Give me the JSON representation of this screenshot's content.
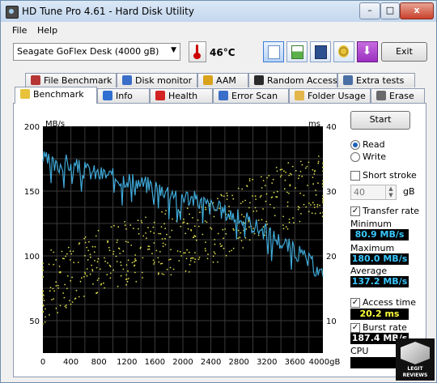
{
  "window": {
    "title": "HD Tune Pro 4.61 - Hard Disk Utility",
    "controls": {
      "minimize": "–",
      "maximize": "□",
      "close": "x"
    }
  },
  "menu": {
    "file": "File",
    "help": "Help"
  },
  "toolbar": {
    "drive": "Seagate GoFlex Desk     (4000 gB)",
    "temperature": "46°C",
    "exit_label": "Exit",
    "icons": [
      "copy-text-icon",
      "copy-screenshot-icon",
      "save-icon",
      "options-icon",
      "download-icon"
    ]
  },
  "tabs_row1": [
    {
      "label": "File Benchmark",
      "icon": "file-benchmark-icon"
    },
    {
      "label": "Disk monitor",
      "icon": "disk-monitor-icon"
    },
    {
      "label": "AAM",
      "icon": "speaker-icon"
    },
    {
      "label": "Random Access",
      "icon": "random-access-icon"
    },
    {
      "label": "Extra tests",
      "icon": "extra-tests-icon"
    }
  ],
  "tabs_row2": [
    {
      "label": "Benchmark",
      "icon": "benchmark-icon",
      "selected": true
    },
    {
      "label": "Info",
      "icon": "info-icon"
    },
    {
      "label": "Health",
      "icon": "health-icon"
    },
    {
      "label": "Error Scan",
      "icon": "error-scan-icon"
    },
    {
      "label": "Folder Usage",
      "icon": "folder-icon"
    },
    {
      "label": "Erase",
      "icon": "erase-icon"
    }
  ],
  "side": {
    "start_label": "Start",
    "read_label": "Read",
    "write_label": "Write",
    "short_stroke_label": "Short stroke",
    "short_stroke_value": "40",
    "short_stroke_unit": "gB",
    "transfer_rate_label": "Transfer rate",
    "minimum_label": "Minimum",
    "minimum_value": "80.9 MB/s",
    "maximum_label": "Maximum",
    "maximum_value": "180.0 MB/s",
    "average_label": "Average",
    "average_value": "137.2 MB/s",
    "access_time_label": "Access time",
    "access_time_value": "20.2 ms",
    "burst_rate_label": "Burst rate",
    "burst_rate_value": "187.4 MB/s",
    "cpu_label": "CPU",
    "read_selected": true,
    "short_stroke_checked": false,
    "transfer_rate_checked": true,
    "access_time_checked": true,
    "burst_rate_checked": true
  },
  "watermark_text": "LEGIT REVIEWS",
  "colors": {
    "transfer_line": "#3fa9d8",
    "access_points": "#d8d84a",
    "plot_bg": "#000000",
    "grid": "#3a3a3a"
  },
  "chart_data": {
    "type": "line",
    "ylabel_left": "MB/s",
    "ylabel_right": "ms",
    "x_ticks": [
      "0",
      "400",
      "800",
      "1200",
      "1600",
      "2000",
      "2400",
      "2800",
      "3200",
      "3600",
      "4000gB"
    ],
    "y_ticks_left": [
      "50",
      "100",
      "150",
      "200"
    ],
    "y_ticks_right": [
      "10",
      "20",
      "30",
      "40"
    ],
    "xlim": [
      0,
      4000
    ],
    "ylim_left": [
      25,
      200
    ],
    "ylim_right": [
      5,
      40
    ],
    "grid": true,
    "series": [
      {
        "axis": "left",
        "x": [
          0,
          100,
          200,
          300,
          400,
          500,
          600,
          700,
          800,
          900,
          1000,
          1100,
          1200,
          1300,
          1400,
          1500,
          1600,
          1700,
          1800,
          1900,
          2000,
          2100,
          2200,
          2300,
          2400,
          2500,
          2600,
          2700,
          2800,
          2900,
          3000,
          3100,
          3200,
          3300,
          3400,
          3500,
          3600,
          3700,
          3800,
          3900,
          4000
        ],
        "values": [
          175,
          172,
          168,
          173,
          170,
          168,
          166,
          165,
          163,
          163,
          161,
          160,
          160,
          158,
          156,
          155,
          154,
          152,
          150,
          149,
          147,
          145,
          143,
          141,
          138,
          136,
          134,
          132,
          129,
          127,
          124,
          121,
          118,
          115,
          111,
          108,
          104,
          100,
          96,
          90,
          84
        ]
      },
      {
        "axis": "right",
        "type": "scatter",
        "x": [
          0,
          200,
          400,
          600,
          800,
          1000,
          1200,
          1400,
          1600,
          1800,
          2000,
          2200,
          2400,
          2600,
          2800,
          3000,
          3200,
          3400,
          3600,
          3800,
          4000
        ],
        "values": [
          14,
          16,
          17,
          18,
          19,
          20,
          20.5,
          21,
          21.5,
          22,
          22.5,
          23,
          24,
          25,
          26,
          27,
          28,
          29,
          30,
          30.5,
          31
        ]
      }
    ]
  }
}
